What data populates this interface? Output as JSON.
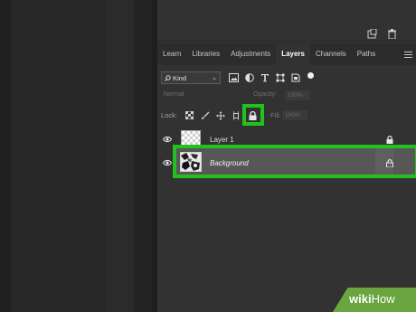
{
  "tabs": [
    {
      "label": "Learn"
    },
    {
      "label": "Libraries"
    },
    {
      "label": "Adjustments"
    },
    {
      "label": "Layers"
    },
    {
      "label": "Channels"
    },
    {
      "label": "Paths"
    }
  ],
  "active_tab": "Layers",
  "filter": {
    "kind_label": "Kind"
  },
  "blend": {
    "mode": "Normal",
    "opacity_label": "Opacity:",
    "opacity_value": "100%"
  },
  "lock": {
    "label": "Lock:",
    "fill_label": "Fill:",
    "fill_value": "100%"
  },
  "layers": [
    {
      "name": "Layer 1",
      "visible": true,
      "locked": true
    },
    {
      "name": "Background",
      "visible": true,
      "locked": true,
      "selected": true
    }
  ],
  "watermark": {
    "bold": "wiki",
    "light": "How"
  },
  "colors": {
    "highlight": "#22c21e",
    "panel": "#323232",
    "selected_row": "#575757",
    "watermark": "#6aa53f"
  }
}
